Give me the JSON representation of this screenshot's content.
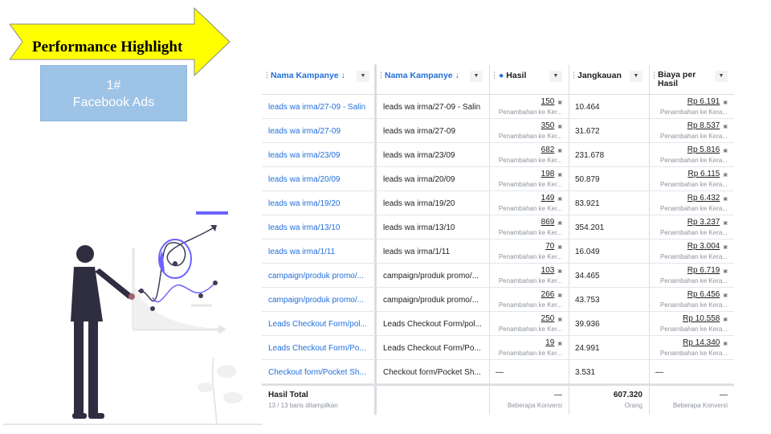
{
  "banner": {
    "title": "Performance Highlight"
  },
  "fb_box": {
    "line1": "1#",
    "line2": "Facebook Ads"
  },
  "table": {
    "headers": {
      "col1": "Nama Kampanye ↓",
      "col2": "Nama Kampanye ↓",
      "col3": "Hasil",
      "col4": "Jangkauan",
      "col5a": "Biaya per",
      "col5b": "Hasil"
    },
    "rows": [
      {
        "name": "leads wa irma/27-09 - Salin",
        "name2": "leads wa irma/27-09 - Salin",
        "hasil": "150",
        "hasil_sub": "Penambahan ke Ker...",
        "jangkauan": "10.464",
        "biaya": "Rp 6.191",
        "biaya_sub": "Penambahan ke Kera..."
      },
      {
        "name": "leads wa irma/27-09",
        "name2": "leads wa irma/27-09",
        "hasil": "350",
        "hasil_sub": "Penambahan ke Ker...",
        "jangkauan": "31.672",
        "biaya": "Rp 8.537",
        "biaya_sub": "Penambahan ke Kera..."
      },
      {
        "name": "leads wa irma/23/09",
        "name2": "leads wa irma/23/09",
        "hasil": "682",
        "hasil_sub": "Penambahan ke Ker...",
        "jangkauan": "231.678",
        "biaya": "Rp 5.816",
        "biaya_sub": "Penambahan ke Kera..."
      },
      {
        "name": "leads wa irma/20/09",
        "name2": "leads wa irma/20/09",
        "hasil": "198",
        "hasil_sub": "Penambahan ke Ker...",
        "jangkauan": "50.879",
        "biaya": "Rp 6.115",
        "biaya_sub": "Penambahan ke Kera..."
      },
      {
        "name": "leads wa irma/19/20",
        "name2": "leads wa irma/19/20",
        "hasil": "149",
        "hasil_sub": "Penambahan ke Ker...",
        "jangkauan": "83.921",
        "biaya": "Rp 6.432",
        "biaya_sub": "Penambahan ke Kera..."
      },
      {
        "name": "leads wa irma/13/10",
        "name2": "leads wa irma/13/10",
        "hasil": "869",
        "hasil_sub": "Penambahan ke Ker...",
        "jangkauan": "354.201",
        "biaya": "Rp 3.237",
        "biaya_sub": "Penambahan ke Kera..."
      },
      {
        "name": "leads wa irma/1/11",
        "name2": "leads wa irma/1/11",
        "hasil": "70",
        "hasil_sub": "Penambahan ke Ker...",
        "jangkauan": "16.049",
        "biaya": "Rp 3.004",
        "biaya_sub": "Penambahan ke Kera..."
      },
      {
        "name": "campaign/produk promo/...",
        "name2": "campaign/produk promo/...",
        "hasil": "103",
        "hasil_sub": "Penambahan ke Ker...",
        "jangkauan": "34.465",
        "biaya": "Rp 6.719",
        "biaya_sub": "Penambahan ke Kera..."
      },
      {
        "name": "campaign/produk promo/...",
        "name2": "campaign/produk promo/...",
        "hasil": "266",
        "hasil_sub": "Penambahan ke Ker...",
        "jangkauan": "43.753",
        "biaya": "Rp 6.456",
        "biaya_sub": "Penambahan ke Kera..."
      },
      {
        "name": "Leads Checkout Form/pol...",
        "name2": "Leads Checkout Form/pol...",
        "hasil": "250",
        "hasil_sub": "Penambahan ke Ker...",
        "jangkauan": "39.936",
        "biaya": "Rp 10.558",
        "biaya_sub": "Penambahan ke Kera..."
      },
      {
        "name": "Leads Checkout Form/Po...",
        "name2": "Leads Checkout Form/Po...",
        "hasil": "19",
        "hasil_sub": "Penambahan ke Ker...",
        "jangkauan": "24.991",
        "biaya": "Rp 14.340",
        "biaya_sub": "Penambahan ke Kera..."
      },
      {
        "name": "Checkout form/Pocket Sh...",
        "name2": "Checkout form/Pocket Sh...",
        "hasil": "—",
        "hasil_sub": "",
        "jangkauan": "3.531",
        "biaya": "—",
        "biaya_sub": ""
      }
    ],
    "total": {
      "label": "Hasil Total",
      "sub": "13 / 13 baris ditampilkan",
      "hasil": "—",
      "hasil_sub": "Beberapa Konversi",
      "jangkauan": "607.320",
      "jangkauan_sub": "Orang",
      "biaya": "—",
      "biaya_sub": "Beberapa Konversi"
    }
  },
  "colors": {
    "accent_blue": "#216fdb",
    "arrow_yellow": "#ffff00",
    "box_blue": "#9dc3e6",
    "purple": "#6c63ff",
    "figure": "#2f2e41"
  }
}
